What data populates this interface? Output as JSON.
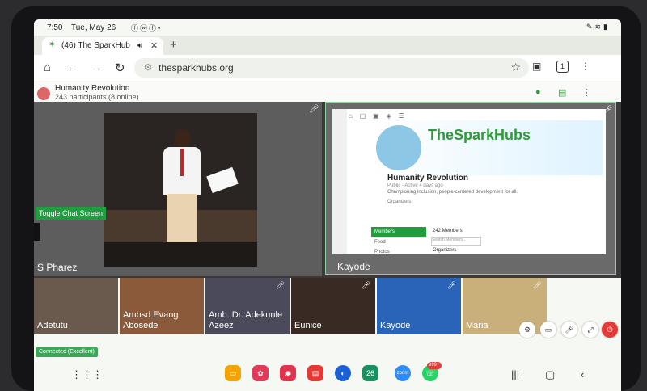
{
  "status_bar": {
    "time": "7:50",
    "date": "Tue, May 26",
    "notification_icons": [
      "facebook-icon",
      "whatsapp-icon",
      "facebook-icon",
      "dot-icon"
    ],
    "system_icons": [
      "pen-icon",
      "wifi-icon",
      "battery-icon"
    ]
  },
  "browser": {
    "tab": {
      "favicon": "sparkhub-favicon",
      "title": "(46) The SparkHub",
      "audio_icon": "speaker-icon"
    },
    "new_tab_symbol": "+",
    "url": "thesparkhubs.org",
    "tab_count": "1"
  },
  "room": {
    "name": "Humanity Revolution",
    "participants": "243 participants (8 online)",
    "toggle_chat_label": "Toggle Chat Screen"
  },
  "stage": {
    "main_speaker": "S Pharez",
    "screen_share_owner": "Kayode"
  },
  "shared_screen": {
    "brand": "TheSparkHubs",
    "group_name": "Humanity Revolution",
    "group_meta": "Public · Active 4 days ago",
    "group_description": "Championing inclusion, people-centered development for all.",
    "organizers_label": "Organizers",
    "members_tab": "Members",
    "feed_tab": "Feed",
    "photos_tab": "Photos",
    "member_count": "242 Members",
    "search_placeholder": "Search Members...",
    "organizers_heading": "Organizers"
  },
  "thumbnails": [
    {
      "name": "Adetutu",
      "color": "#6a5a4e"
    },
    {
      "name": "Ambsd Evang Abosede",
      "color": "#8a5a3a"
    },
    {
      "name": "Amb. Dr. Adekunle Azeez",
      "color": "#4a4a5a"
    },
    {
      "name": "Eunice",
      "color": "#3a2a24"
    },
    {
      "name": "Kayode",
      "color": "#2a64b8"
    },
    {
      "name": "Maria",
      "color": "#c9b07a"
    }
  ],
  "connection_status": "Connected (Excellent)",
  "call_controls": [
    "settings-icon",
    "camera-off-icon",
    "mic-off-icon",
    "fullscreen-icon",
    "leave-call-icon"
  ],
  "dock": {
    "apps": [
      {
        "name": "folder",
        "color": "#f4a400"
      },
      {
        "name": "gallery",
        "color": "#e23b5a"
      },
      {
        "name": "camera",
        "color": "#e0334e"
      },
      {
        "name": "notes",
        "color": "#e53935"
      },
      {
        "name": "browser",
        "color": "#1a5fd6"
      },
      {
        "name": "calendar",
        "color": "#1a8f5f",
        "label": "26"
      },
      {
        "name": "zoom",
        "color": "#2d8cff",
        "label": "zoom"
      },
      {
        "name": "whatsapp",
        "color": "#25d366",
        "badge": "999+"
      }
    ]
  }
}
